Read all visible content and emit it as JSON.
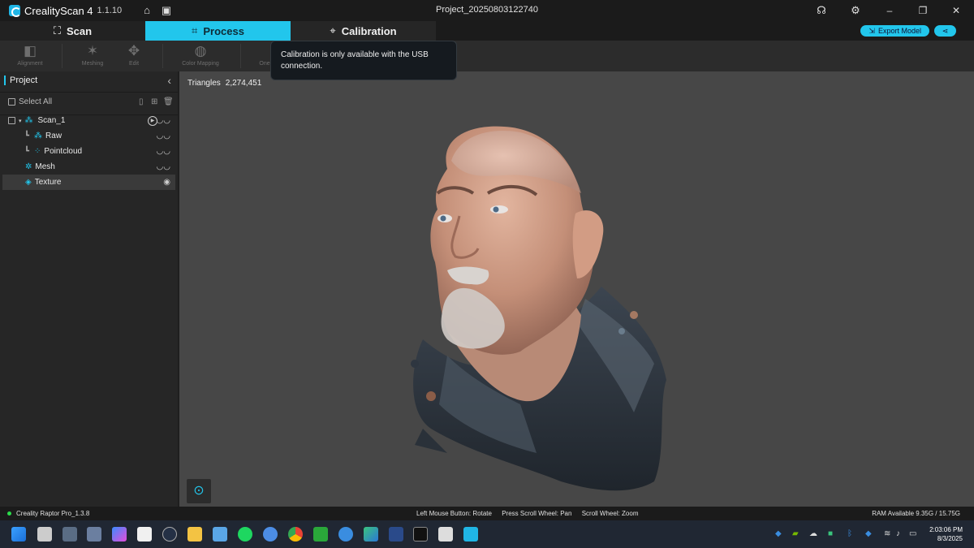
{
  "app": {
    "name": "CrealityScan 4",
    "version": "1.1.10",
    "window_title": "Project_20250803122740"
  },
  "titlebar": {
    "home_icon": "home-icon",
    "folder_icon": "folder-icon",
    "support_icon": "headset-icon",
    "settings_icon": "gear-icon",
    "minimize": "–",
    "restore": "❐",
    "close": "✕"
  },
  "modes": [
    {
      "label": "Scan",
      "icon": "scan-icon",
      "active": false
    },
    {
      "label": "Process",
      "icon": "crop-icon",
      "active": true
    },
    {
      "label": "Calibration",
      "icon": "target-icon",
      "active": false
    }
  ],
  "header_actions": {
    "export_label": "Export Model",
    "share_icon": "share-icon"
  },
  "tools": [
    {
      "label": "Alignment",
      "icon": "alignment-icon"
    },
    {
      "label": "Meshing",
      "icon": "meshing-icon"
    },
    {
      "label": "Edit",
      "icon": "edit-icon"
    },
    {
      "label": "Color Mapping",
      "icon": "palette-icon"
    },
    {
      "label": "One",
      "icon": "one-click-icon"
    }
  ],
  "tooltip": {
    "text": "Calibration is only available with the USB connection."
  },
  "panel": {
    "title": "Project",
    "select_all": "Select All",
    "items": [
      {
        "label": "Scan_1",
        "visibility": "hidden"
      },
      {
        "label": "Raw",
        "visibility": "hidden"
      },
      {
        "label": "Pointcloud",
        "visibility": "hidden"
      },
      {
        "label": "Mesh",
        "visibility": "hidden"
      },
      {
        "label": "Texture",
        "visibility": "visible"
      }
    ]
  },
  "viewport": {
    "triangles_label": "Triangles",
    "triangles_value": "2,274,451"
  },
  "status": {
    "device": "Creality Raptor Pro_1.3.8",
    "hints": [
      "Left Mouse Button: Rotate",
      "Press Scroll Wheel: Pan",
      "Scroll Wheel: Zoom"
    ],
    "ram": "RAM Available 9.35G / 15.75G"
  },
  "taskbar": {
    "time": "2:03:06 PM",
    "date": "8/3/2025"
  },
  "colors": {
    "accent": "#22c6ec",
    "background": "#1f1f1f",
    "viewport": "#474747",
    "status_ok": "#2bdc4a"
  }
}
